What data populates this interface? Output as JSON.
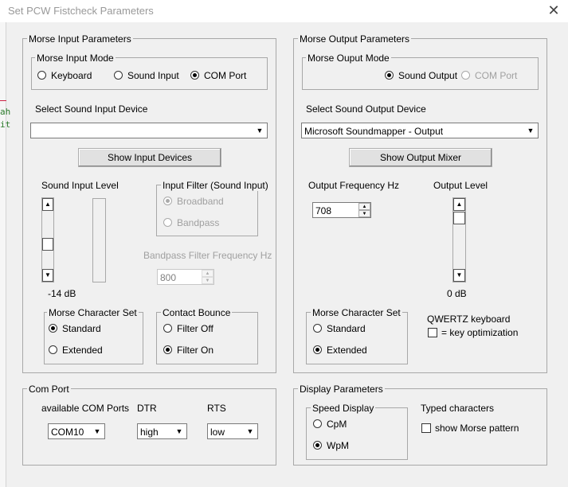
{
  "window": {
    "title": "Set PCW Fistcheck Parameters",
    "close_symbol": "✕"
  },
  "background_text": {
    "line1": "ah",
    "line2": "it"
  },
  "morse_input": {
    "group_label": "Morse Input Parameters",
    "mode": {
      "label": "Morse Input Mode",
      "options": [
        "Keyboard",
        "Sound Input",
        "COM Port"
      ],
      "selected": "COM Port"
    },
    "device_label": "Select Sound Input Device",
    "device_value": "",
    "show_devices_button": "Show Input Devices",
    "level_label": "Sound Input Level",
    "level_value": "-14 dB",
    "filter": {
      "label": "Input Filter (Sound Input)",
      "options": [
        "Broadband",
        "Bandpass"
      ],
      "selected": "Broadband",
      "enabled": false
    },
    "bandpass_label": "Bandpass Filter Frequency Hz",
    "bandpass_value": "800",
    "charset": {
      "label": "Morse Character Set",
      "options": [
        "Standard",
        "Extended"
      ],
      "selected": "Standard"
    },
    "bounce": {
      "label": "Contact Bounce",
      "options": [
        "Filter Off",
        "Filter On"
      ],
      "selected": "Filter On"
    }
  },
  "morse_output": {
    "group_label": "Morse Output Parameters",
    "mode": {
      "label": "Morse Ouput Mode",
      "options": [
        "Sound Output",
        "COM Port"
      ],
      "selected": "Sound Output"
    },
    "device_label": "Select Sound Output Device",
    "device_value": "Microsoft Soundmapper - Output",
    "mixer_button": "Show Output Mixer",
    "freq_label": "Output Frequency Hz",
    "freq_value": "708",
    "level_label": "Output Level",
    "level_value": "0 dB",
    "charset": {
      "label": "Morse Character Set",
      "options": [
        "Standard",
        "Extended"
      ],
      "selected": "Extended"
    },
    "qwertz_label": "QWERTZ keyboard",
    "qwertz_checkbox_label": "= key optimization",
    "qwertz_checked": false
  },
  "com_port": {
    "group_label": "Com Port",
    "ports_label": "available COM Ports",
    "ports_value": "COM10",
    "dtr_label": "DTR",
    "dtr_value": "high",
    "rts_label": "RTS",
    "rts_value": "low"
  },
  "display": {
    "group_label": "Display Parameters",
    "speed": {
      "label": "Speed Display",
      "options": [
        "CpM",
        "WpM"
      ],
      "selected": "WpM"
    },
    "typed_label": "Typed characters",
    "pattern_label": "show Morse pattern",
    "pattern_checked": false
  }
}
